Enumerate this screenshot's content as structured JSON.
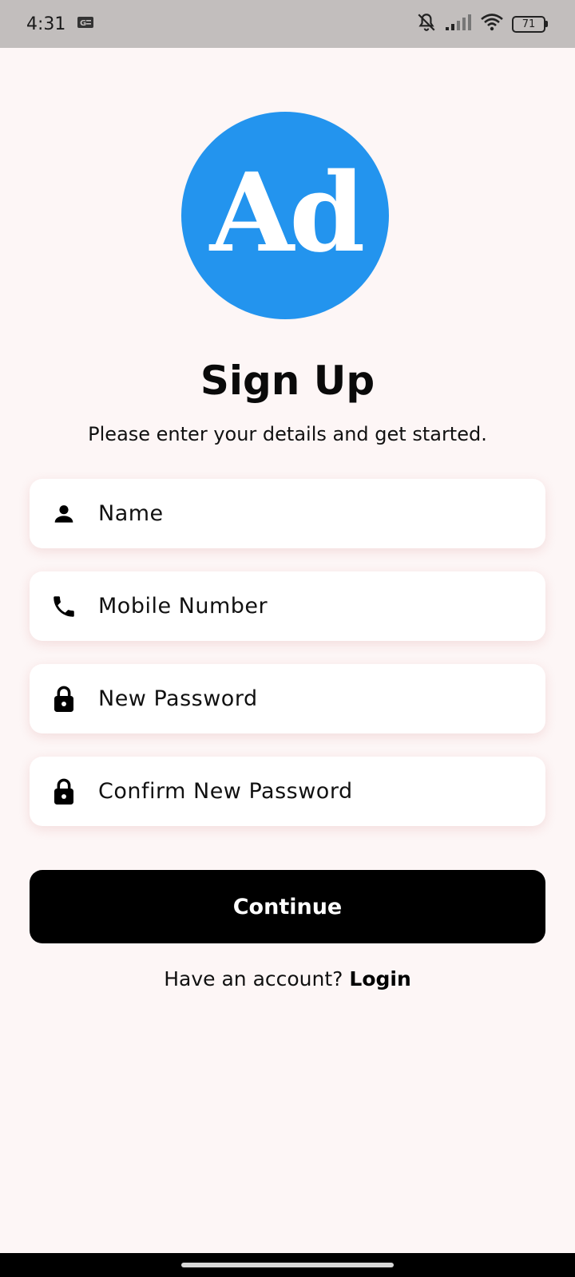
{
  "status_bar": {
    "time": "4:31",
    "battery": "71",
    "icons": [
      "notification-app-icon",
      "bell-off-icon",
      "signal-icon",
      "wifi-icon",
      "battery-icon"
    ]
  },
  "logo": {
    "text": "Ad",
    "color": "#2394ee"
  },
  "title": "Sign Up",
  "subtitle": "Please enter your details and get started.",
  "fields": [
    {
      "placeholder": "Name",
      "icon": "person-icon"
    },
    {
      "placeholder": "Mobile Number",
      "icon": "phone-icon"
    },
    {
      "placeholder": "New Password",
      "icon": "lock-icon"
    },
    {
      "placeholder": "Confirm New Password",
      "icon": "lock-icon"
    }
  ],
  "continue_label": "Continue",
  "login_prompt": "Have an account?",
  "login_link": "Login"
}
